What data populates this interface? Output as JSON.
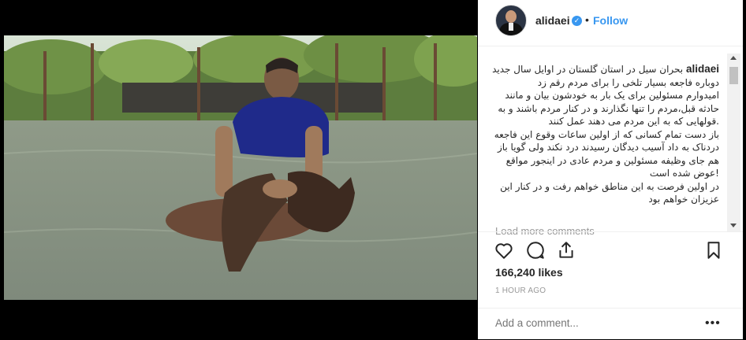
{
  "post": {
    "username": "alidaei",
    "verified_icon": "verified-badge-icon",
    "separator": "•",
    "follow_label": "Follow",
    "caption_user": "alidaei",
    "caption_lines": [
      "بحران سیل در استان گلستان در اوایل سال جدید",
      "دوباره فاجعه بسیار تلخی را برای مردم رقم زد",
      "امیدوارم مسئولین برای یک بار به خودشون بیان و مانند",
      "حادثه قبل،مردم را تنها نگذارند و در کنار مردم باشند و به",
      ".قولهایی که به این مردم می دهند عمل کنند",
      "باز دست تمام کسانی که از اولین ساعات وقوع این فاجعه",
      "دردناک به داد آسیب دیدگان رسیدند درد نکند ولی گویا باز",
      "هم جای وظیفه مسئولین و مردم عادی در اینجور مواقع",
      "!عوض شده است",
      "در اولین فرصت به این مناطق خواهم رفت و در کنار این",
      "عزیزان خواهم بود"
    ],
    "load_more": "Load more comments",
    "likes": "166,240 likes",
    "time": "1 HOUR AGO",
    "comment_placeholder": "Add a comment...",
    "more_label": "•••"
  },
  "icons": {
    "like": "heart-icon",
    "comment": "comment-icon",
    "share": "share-icon",
    "save": "bookmark-icon"
  },
  "colors": {
    "accent": "#3897f0",
    "text": "#262626",
    "muted": "#999999"
  }
}
